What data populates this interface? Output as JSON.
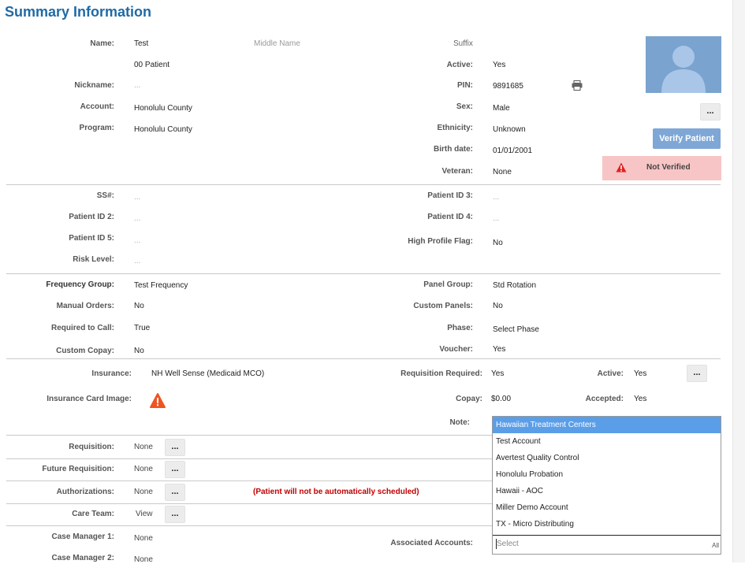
{
  "title": "Summary Information",
  "demographics": {
    "name_label": "Name:",
    "first_name": "Test",
    "middle_name_placeholder": "Middle Name",
    "suffix_placeholder": "Suffix",
    "last_name": "00 Patient",
    "active_label": "Active:",
    "active_value": "Yes",
    "nickname_label": "Nickname:",
    "nickname_value": "...",
    "pin_label": "PIN:",
    "pin_value": "9891685",
    "account_label": "Account:",
    "account_value": "Honolulu County",
    "sex_label": "Sex:",
    "sex_value": "Male",
    "program_label": "Program:",
    "program_value": "Honolulu County",
    "ethnicity_label": "Ethnicity:",
    "ethnicity_value": "Unknown",
    "birth_label": "Birth date:",
    "birth_value": "01/01/2001",
    "veteran_label": "Veteran:",
    "veteran_value": "None",
    "verify_button": "Verify Patient",
    "not_verified": "Not Verified",
    "more_button": "..."
  },
  "ids": {
    "ssn_label": "SS#:",
    "ssn_value": "...",
    "pid3_label": "Patient ID 3:",
    "pid3_value": "...",
    "pid2_label": "Patient ID 2:",
    "pid2_value": "...",
    "pid4_label": "Patient ID 4:",
    "pid4_value": "...",
    "pid5_label": "Patient ID 5:",
    "pid5_value": "...",
    "hpf_label": "High Profile Flag:",
    "hpf_value": "No",
    "risk_label": "Risk Level:",
    "risk_value": "..."
  },
  "testing": {
    "freq_label": "Frequency Group:",
    "freq_value": "Test Frequency",
    "panel_label": "Panel Group:",
    "panel_value": "Std Rotation",
    "manual_label": "Manual Orders:",
    "manual_value": "No",
    "custom_panels_label": "Custom Panels:",
    "custom_panels_value": "No",
    "req_call_label": "Required to Call:",
    "req_call_value": "True",
    "phase_label": "Phase:",
    "phase_value": "Select Phase",
    "copay_label": "Custom Copay:",
    "copay_value": "No",
    "voucher_label": "Voucher:",
    "voucher_value": "Yes"
  },
  "insurance": {
    "insurance_label": "Insurance:",
    "insurance_value": "NH Well Sense (Medicaid MCO)",
    "req_required_label": "Requisition Required:",
    "req_required_value": "Yes",
    "active_label": "Active:",
    "active_value": "Yes",
    "card_label": "Insurance Card Image:",
    "copay_label": "Copay:",
    "copay_value": "$0.00",
    "accepted_label": "Accepted:",
    "accepted_value": "Yes",
    "note_label": "Note:"
  },
  "links": {
    "requisition_label": "Requisition:",
    "requisition_value": "None",
    "future_label": "Future Requisition:",
    "future_value": "None",
    "auth_label": "Authorizations:",
    "auth_value": "None",
    "auth_note": "(Patient will not be automatically scheduled)",
    "care_label": "Care Team:",
    "care_value": "View",
    "cm1_label": "Case Manager 1:",
    "cm1_value": "None",
    "cm2_label": "Case Manager 2:",
    "cm2_value": "None",
    "assoc_label": "Associated Accounts:"
  },
  "dropdown": {
    "options": [
      "Hawaiian Treatment Centers",
      "Test Account",
      "Avertest Quality Control",
      "Honolulu Probation",
      "Hawaii - AOC",
      "Miller Demo Account",
      "TX - Micro Distributing"
    ],
    "selected_index": 0,
    "search_placeholder": "Select",
    "all_label": "All"
  }
}
